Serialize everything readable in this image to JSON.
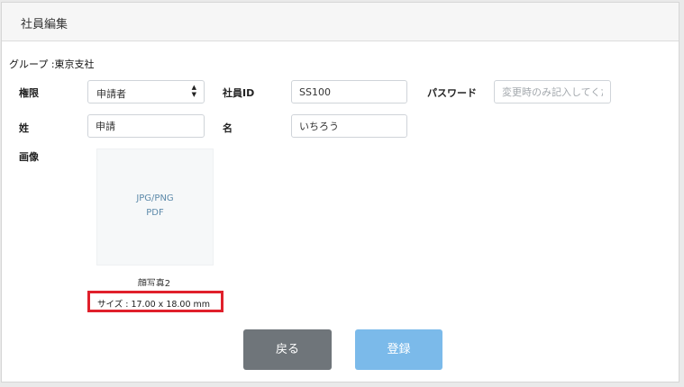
{
  "header": {
    "title": "社員編集"
  },
  "group": {
    "label": "グループ :",
    "value": "東京支社"
  },
  "form": {
    "role_label": "権限",
    "role_value": "申請者",
    "employee_id_label": "社員ID",
    "employee_id_value": "SS100",
    "password_label": "パスワード",
    "password_placeholder": "変更時のみ記入してくだ",
    "last_name_label": "姓",
    "last_name_value": "申請",
    "first_name_label": "名",
    "first_name_value": "いちろう",
    "image_label": "画像"
  },
  "upload": {
    "line1": "JPG/PNG",
    "line2": "PDF",
    "name": "顔写真2",
    "size": "サイズ : 17.00 x 18.00 mm"
  },
  "buttons": {
    "back": "戻る",
    "save": "登録"
  },
  "colors": {
    "back": "#6f757a",
    "save": "#7bbaea",
    "highlight": "#e0202b"
  }
}
